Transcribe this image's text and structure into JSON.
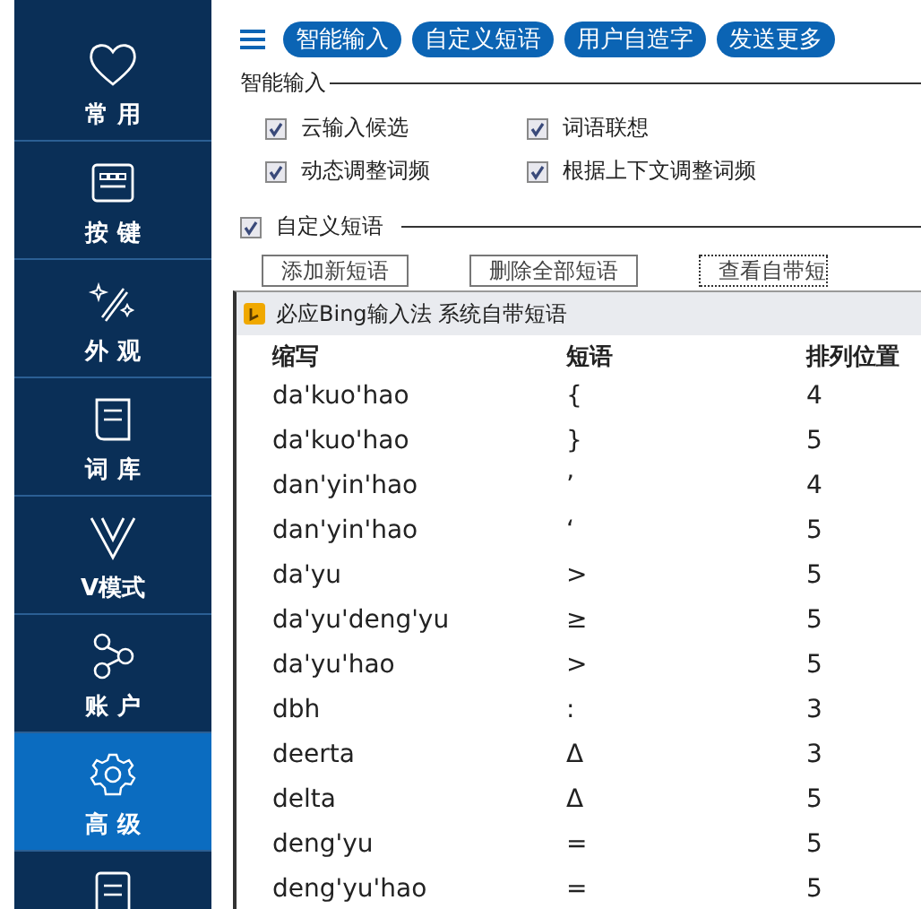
{
  "sidebar": {
    "items": [
      {
        "kind": "heart",
        "label": "常 用",
        "selected": false
      },
      {
        "kind": "keyboard",
        "label": "按 键",
        "selected": false
      },
      {
        "kind": "wand",
        "label": "外 观",
        "selected": false
      },
      {
        "kind": "book",
        "label": "词 库",
        "selected": false
      },
      {
        "kind": "v",
        "label": "V模式",
        "selected": false
      },
      {
        "kind": "nodes",
        "label": "账 户",
        "selected": false
      },
      {
        "kind": "gear",
        "label": "高 级",
        "selected": true
      },
      {
        "kind": "doc",
        "selected": false
      }
    ]
  },
  "tabs": [
    {
      "label": "智能输入"
    },
    {
      "label": "自定义短语"
    },
    {
      "label": "用户自造字"
    },
    {
      "label": "发送更多"
    }
  ],
  "smart_input": {
    "title": "智能输入",
    "options": [
      {
        "label": "云输入候选",
        "checked": true
      },
      {
        "label": "词语联想",
        "checked": true
      },
      {
        "label": "动态调整词频",
        "checked": true
      },
      {
        "label": "根据上下文调整词频",
        "checked": true
      }
    ]
  },
  "custom_phrases": {
    "label": "自定义短语",
    "checked": true,
    "buttons": [
      "添加新短语",
      "删除全部短语",
      "查看自带短"
    ]
  },
  "dialog": {
    "title": "必应Bing输入法 系统自带短语",
    "columns": [
      "缩写",
      "短语",
      "排列位置"
    ],
    "rows": [
      [
        "da'kuo'hao",
        "{",
        "4"
      ],
      [
        "da'kuo'hao",
        "}",
        "5"
      ],
      [
        "dan'yin'hao",
        "’",
        "4"
      ],
      [
        "dan'yin'hao",
        "‘",
        "5"
      ],
      [
        "da'yu",
        ">",
        "5"
      ],
      [
        "da'yu'deng'yu",
        "≥",
        "5"
      ],
      [
        "da'yu'hao",
        ">",
        "5"
      ],
      [
        "dbh",
        ":",
        "3"
      ],
      [
        "deerta",
        "Δ",
        "3"
      ],
      [
        "delta",
        "Δ",
        "5"
      ],
      [
        "deng'yu",
        "=",
        "5"
      ],
      [
        "deng'yu'hao",
        "=",
        "5"
      ]
    ]
  }
}
